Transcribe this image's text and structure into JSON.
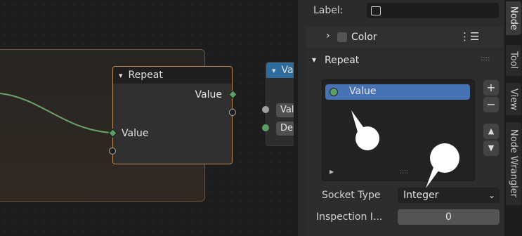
{
  "canvas": {
    "repeat_node": {
      "title": "Repeat",
      "output_label": "Value",
      "input_label": "Value"
    },
    "value_node": {
      "title": "Va",
      "fields": [
        "Val",
        "De"
      ]
    }
  },
  "panel": {
    "label_field": {
      "label": "Label:"
    },
    "color_section": {
      "label": "Color"
    },
    "repeat_section": {
      "title": "Repeat",
      "items": [
        {
          "label": "Value",
          "socket_color": "#5b9e65"
        }
      ],
      "add_button": "+",
      "remove_button": "−",
      "move_up": "▲",
      "move_down": "▼"
    },
    "socket_type": {
      "label": "Socket Type",
      "value": "Integer"
    },
    "inspection": {
      "label": "Inspection I...",
      "value": "0"
    }
  },
  "tabs": [
    {
      "label": "Node",
      "active": true
    },
    {
      "label": "Tool",
      "active": false
    },
    {
      "label": "View",
      "active": false
    },
    {
      "label": "Node Wrangler",
      "active": false
    }
  ],
  "colors": {
    "accent": "#4772b3",
    "node_border": "#bf8a55",
    "value_header": "#2e6c9e",
    "link": "#6ba36f"
  }
}
